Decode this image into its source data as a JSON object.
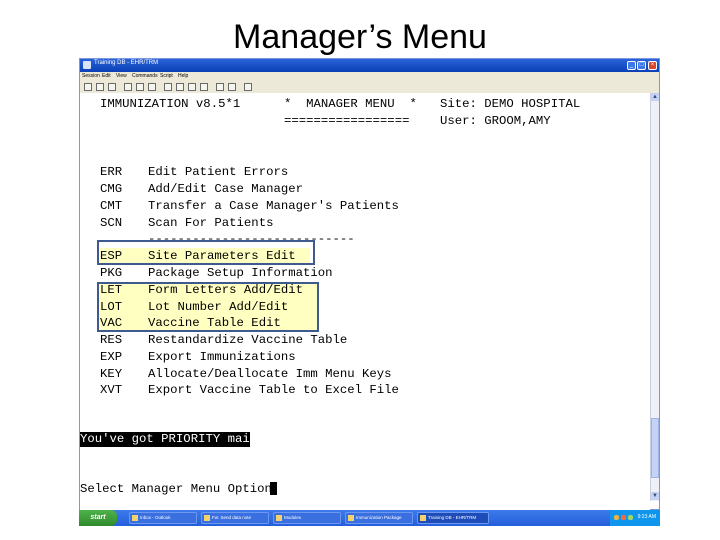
{
  "slide": {
    "title": "Manager’s Menu"
  },
  "window": {
    "title": "Training DB - EHR/TRM"
  },
  "menubar": [
    "Session",
    "Edit",
    "View",
    "Commands",
    "Script",
    "Help"
  ],
  "terminal": {
    "header_left": "IMMUNIZATION v8.5*1",
    "header_center": "*  MANAGER MENU  *",
    "header_underline": "=================",
    "site_line": "Site: DEMO HOSPITAL",
    "user_line": "User: GROOM,AMY",
    "menu_items": [
      {
        "code": "ERR",
        "label": "Edit Patient Errors"
      },
      {
        "code": "CMG",
        "label": "Add/Edit Case Manager"
      },
      {
        "code": "CMT",
        "label": "Transfer a Case Manager's Patients"
      },
      {
        "code": "SCN",
        "label": "Scan For Patients"
      },
      {
        "code": "",
        "label": "----------------------------"
      },
      {
        "code": "ESP",
        "label": "Site Parameters Edit"
      },
      {
        "code": "PKG",
        "label": "Package Setup Information"
      },
      {
        "code": "LET",
        "label": "Form Letters Add/Edit"
      },
      {
        "code": "LOT",
        "label": "Lot Number Add/Edit"
      },
      {
        "code": "VAC",
        "label": "Vaccine Table Edit"
      },
      {
        "code": "RES",
        "label": "Restandardize Vaccine Table"
      },
      {
        "code": "EXP",
        "label": "Export Immunizations"
      },
      {
        "code": "KEY",
        "label": "Allocate/Deallocate Imm Menu Keys"
      },
      {
        "code": "XVT",
        "label": "Export Vaccine Table to Excel File"
      }
    ],
    "mail_notice": "You've got PRIORITY mail!",
    "prompt": "Select Manager Menu Option: "
  },
  "taskbar": {
    "start": "start",
    "tasks": [
      "Inbox - Outlook",
      "Fw: Send data note",
      "Modules",
      "Immunization Package",
      "Training DB - EHR/TRM"
    ],
    "clock": "9:23 AM"
  }
}
